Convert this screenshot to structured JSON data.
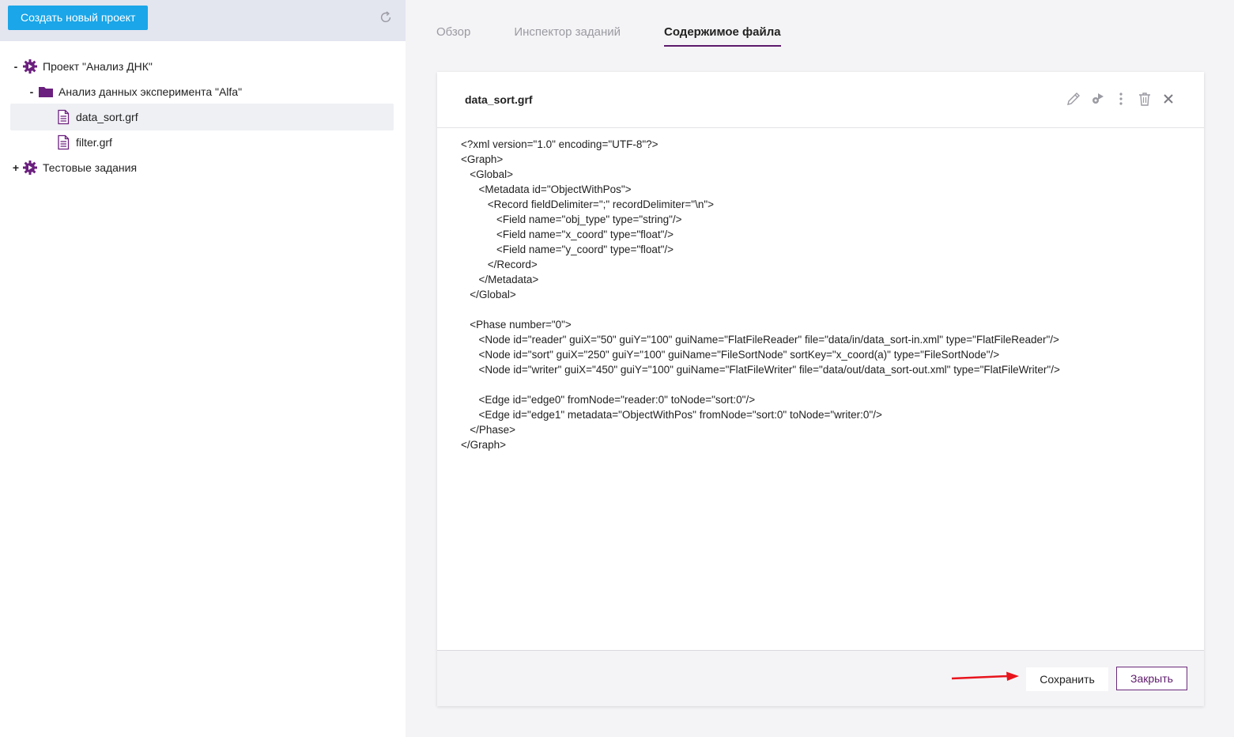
{
  "sidebar": {
    "create_button": "Создать новый проект",
    "tree": [
      {
        "toggle": "-",
        "icon": "gear-icon",
        "label": "Проект \"Анализ ДНК\""
      },
      {
        "toggle": "-",
        "icon": "folder-icon",
        "label": "Анализ данных эксперимента \"Alfa\""
      },
      {
        "toggle": "",
        "icon": "file-icon",
        "label": "data_sort.grf",
        "selected": true
      },
      {
        "toggle": "",
        "icon": "file-icon",
        "label": "filter.grf"
      },
      {
        "toggle": "+",
        "icon": "gear-icon",
        "label": "Тестовые задания"
      }
    ]
  },
  "tabs": [
    {
      "label": "Обзор"
    },
    {
      "label": "Инспектор заданий"
    },
    {
      "label": "Содержимое файла",
      "active": true
    }
  ],
  "file": {
    "title": "data_sort.grf",
    "code_lines": [
      "<?xml version=\"1.0\" encoding=\"UTF-8\"?>",
      "<Graph>",
      "   <Global>",
      "      <Metadata id=\"ObjectWithPos\">",
      "         <Record fieldDelimiter=\";\" recordDelimiter=\"\\n\">",
      "            <Field name=\"obj_type\" type=\"string\"/>",
      "            <Field name=\"x_coord\" type=\"float\"/>",
      "            <Field name=\"y_coord\" type=\"float\"/>",
      "         </Record>",
      "      </Metadata>",
      "   </Global>",
      "",
      "   <Phase number=\"0\">",
      "      <Node id=\"reader\" guiX=\"50\" guiY=\"100\" guiName=\"FlatFileReader\" file=\"data/in/data_sort-in.xml\" type=\"FlatFileReader\"/>",
      "      <Node id=\"sort\" guiX=\"250\" guiY=\"100\" guiName=\"FileSortNode\" sortKey=\"x_coord(a)\" type=\"FileSortNode\"/>",
      "      <Node id=\"writer\" guiX=\"450\" guiY=\"100\" guiName=\"FlatFileWriter\" file=\"data/out/data_sort-out.xml\" type=\"FlatFileWriter\"/>",
      "",
      "      <Edge id=\"edge0\" fromNode=\"reader:0\" toNode=\"sort:0\"/>",
      "      <Edge id=\"edge1\" metadata=\"ObjectWithPos\" fromNode=\"sort:0\" toNode=\"writer:0\"/>",
      "   </Phase>",
      "</Graph>"
    ]
  },
  "footer": {
    "save_label": "Сохранить",
    "close_label": "Закрыть"
  },
  "colors": {
    "accent_blue": "#1aa6e8",
    "brand_purple": "#5d1a6b",
    "arrow_red": "#e8141c"
  }
}
